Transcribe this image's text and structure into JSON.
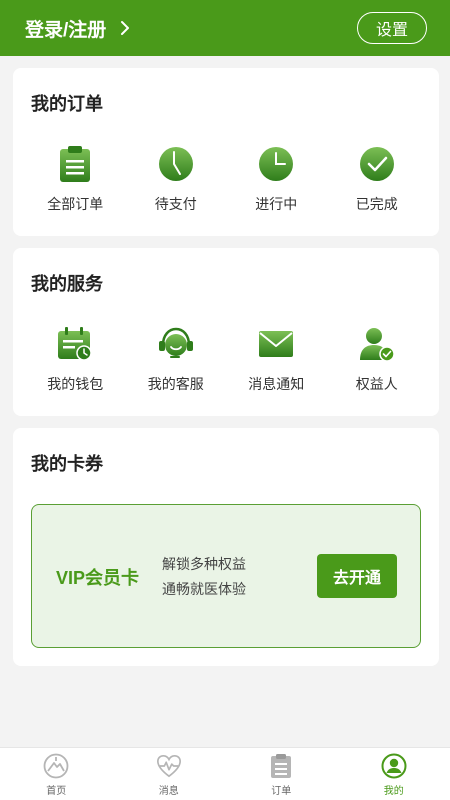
{
  "header": {
    "login_label": "登录/注册",
    "settings_label": "设置"
  },
  "orders": {
    "title": "我的订单",
    "items": [
      {
        "label": "全部订单",
        "icon": "clipboard-icon"
      },
      {
        "label": "待支付",
        "icon": "clock-pending-icon"
      },
      {
        "label": "进行中",
        "icon": "clock-icon"
      },
      {
        "label": "已完成",
        "icon": "check-circle-icon"
      }
    ]
  },
  "services": {
    "title": "我的服务",
    "items": [
      {
        "label": "我的钱包",
        "icon": "wallet-icon"
      },
      {
        "label": "我的客服",
        "icon": "headset-icon"
      },
      {
        "label": "消息通知",
        "icon": "mail-icon"
      },
      {
        "label": "权益人",
        "icon": "user-badge-icon"
      }
    ]
  },
  "cards": {
    "title": "我的卡券",
    "vip": {
      "title": "VIP会员卡",
      "desc_line1": "解锁多种权益",
      "desc_line2": "通畅就医体验",
      "button_label": "去开通"
    }
  },
  "tabbar": {
    "items": [
      {
        "label": "首页",
        "icon": "home-icon"
      },
      {
        "label": "消息",
        "icon": "heartbeat-icon"
      },
      {
        "label": "订单",
        "icon": "clipboard-icon"
      },
      {
        "label": "我的",
        "icon": "profile-icon",
        "active": true
      }
    ]
  },
  "colors": {
    "brand": "#4a9a1a",
    "vip_background": "#eaf4e6",
    "tab_inactive": "#b5b5b5"
  }
}
